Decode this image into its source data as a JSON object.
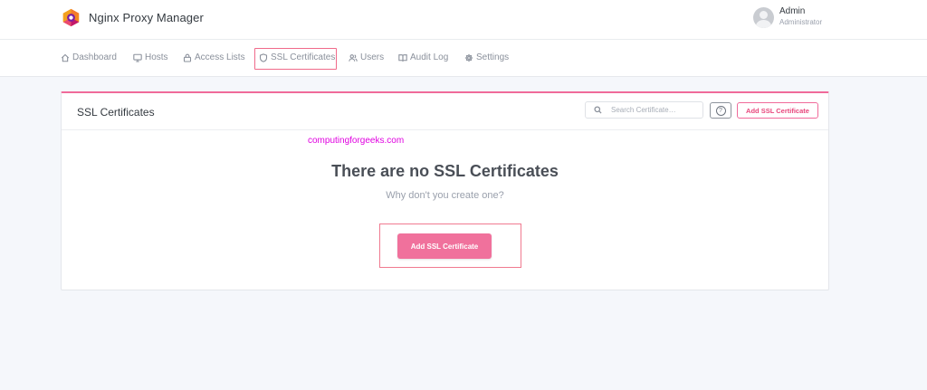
{
  "header": {
    "app_title": "Nginx Proxy Manager",
    "logo_icon": "hexagon-logo-icon",
    "user": {
      "name": "Admin",
      "role": "Administrator"
    }
  },
  "nav": {
    "items": [
      {
        "label": "Dashboard",
        "icon": "home-icon"
      },
      {
        "label": "Hosts",
        "icon": "monitor-icon"
      },
      {
        "label": "Access Lists",
        "icon": "lock-icon"
      },
      {
        "label": "SSL Certificates",
        "icon": "shield-icon",
        "active": true
      },
      {
        "label": "Users",
        "icon": "users-icon"
      },
      {
        "label": "Audit Log",
        "icon": "book-icon"
      },
      {
        "label": "Settings",
        "icon": "gear-icon"
      }
    ]
  },
  "card": {
    "title": "SSL Certificates",
    "search_placeholder": "Search Certificate…",
    "help_label": "?",
    "add_button_label": "Add SSL Certificate",
    "watermark": "computingforgeeks.com",
    "empty_title": "There are no SSL Certificates",
    "empty_subtitle": "Why don't you create one?",
    "empty_add_button_label": "Add SSL Certificate"
  },
  "colors": {
    "accent": "#f0719c",
    "highlight_box": "#f06a8a",
    "watermark": "#e000e0"
  }
}
